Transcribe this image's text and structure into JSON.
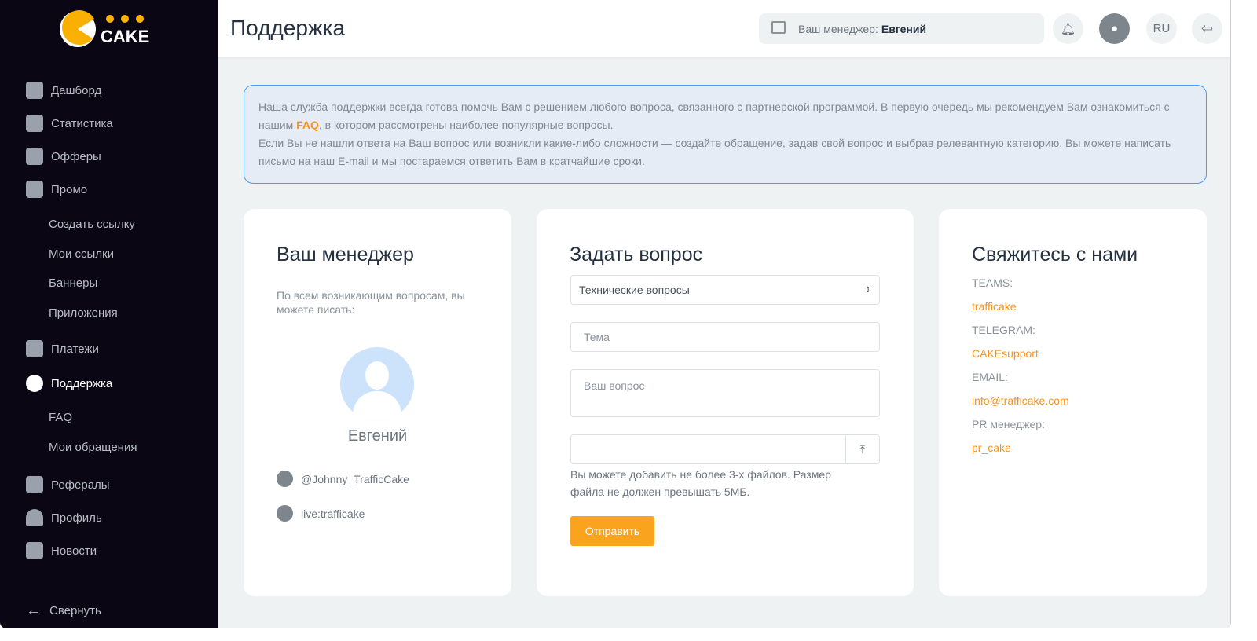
{
  "logo": "CAKE",
  "sidebar": {
    "items": [
      {
        "label": "Дашборд"
      },
      {
        "label": "Статистика"
      },
      {
        "label": "Офферы"
      },
      {
        "label": "Промо"
      },
      {
        "label": "Платежи"
      },
      {
        "label": "Поддержка"
      },
      {
        "label": "Рефералы"
      },
      {
        "label": "Профиль"
      },
      {
        "label": "Новости"
      }
    ],
    "promo_sub": [
      "Создать ссылку",
      "Мои ссылки",
      "Баннеры",
      "Приложения"
    ],
    "support_sub": [
      "FAQ",
      "Мои обращения"
    ],
    "collapse": "Свернуть"
  },
  "header": {
    "title": "Поддержка",
    "manager_label": "Ваш менеджер:",
    "manager_name": "Евгений",
    "lang": "RU"
  },
  "info": {
    "p1": "Наша служба поддержки всегда готова помочь Вам с решением любого вопроса, связанного с партнерской программой. В первую очередь мы рекомендуем Вам ознакомиться с нашим ",
    "faq": "FAQ",
    "p1b": ", в котором рассмотрены наиболее популярные вопросы.",
    "p2": "Если Вы не нашли ответа на Ваш вопрос или возникли какие-либо сложности — создайте обращение, задав свой вопрос и выбрав релевантную категорию. Вы можете написать письмо на наш E-mail и мы постараемся ответить Вам в кратчайшие сроки."
  },
  "manager_card": {
    "title": "Ваш менеджер",
    "text": "По всем возникающим вопросам, вы можете писать:",
    "name": "Евгений",
    "telegram": "@Johnny_TrafficCake",
    "teams": "live:trafficake"
  },
  "question_card": {
    "title": "Задать вопрос",
    "category": "Технические вопросы",
    "subject_placeholder": "Тема",
    "question_placeholder": "Ваш вопрос",
    "file_note": "Вы можете добавить не более 3-х файлов. Размер файла не должен превышать 5МБ.",
    "submit": "Отправить"
  },
  "contact_card": {
    "title": "Свяжитесь с нами",
    "items": [
      {
        "label": "TEAMS:",
        "value": "trafficake"
      },
      {
        "label": "TELEGRAM:",
        "value": "CAKEsupport"
      },
      {
        "label": "EMAIL:",
        "value": "info@trafficake.com"
      },
      {
        "label": "PR менеджер:",
        "value": "pr_cake"
      }
    ]
  },
  "colors": {
    "accent": "#f7931e",
    "sidebar": "#0b0614",
    "info_border": "#4d9af0"
  }
}
